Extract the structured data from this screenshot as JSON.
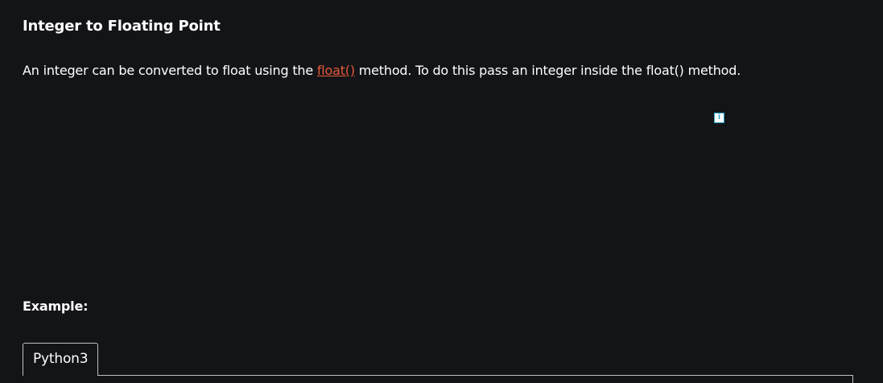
{
  "article": {
    "heading": "Integer to Floating Point",
    "paragraph": {
      "before": "An integer can be converted to float using the ",
      "link": "float()",
      "after": " method. To do this pass an integer inside the float() method."
    },
    "ad": {
      "info_glyph": "i",
      "icon": "ad-info-icon"
    },
    "example_label": "Example:",
    "code_tabs": [
      {
        "label": "Python3",
        "active": true
      }
    ]
  },
  "colors": {
    "background": "#131417",
    "text": "#ffffff",
    "link": "#e35a3a",
    "border": "#bfbfbf",
    "ad_icon": "#2aa6c7"
  }
}
